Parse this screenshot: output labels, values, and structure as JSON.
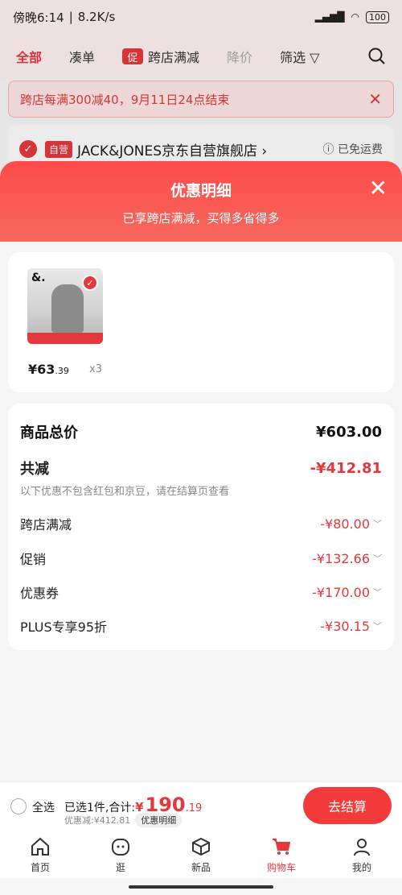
{
  "status_bar": {
    "time": "傍晚6:14",
    "speed": "8.2K/s",
    "battery": "100"
  },
  "tabs": [
    {
      "label": "全部"
    },
    {
      "label": "凑单"
    },
    {
      "label": "跨店满减",
      "badge": "促"
    },
    {
      "label": "降价"
    },
    {
      "label": "筛选"
    }
  ],
  "banner": {
    "text": "跨店每满300减40，9月11日24点结束"
  },
  "shop": {
    "badge": "自营",
    "name": "JACK&JONES京东自营旗舰店 ›",
    "shipping": "ⓘ 已免运费"
  },
  "sheet": {
    "title": "优惠明细",
    "subtitle": "已享跨店满减，买得多省得多",
    "product": {
      "price_int": "¥63",
      "price_dec": ".39",
      "qty": "x3",
      "thumb_text": "&."
    },
    "total_label": "商品总价",
    "total_value": "¥603.00",
    "saving_label": "共减",
    "saving_value": "-¥412.81",
    "note": "以下优惠不包含红包和京豆，请在结算页查看",
    "items": [
      {
        "label": "跨店满减",
        "value": "-¥80.00"
      },
      {
        "label": "促销",
        "value": "-¥132.66"
      },
      {
        "label": "优惠券",
        "value": "-¥170.00"
      },
      {
        "label": "PLUS专享95折",
        "value": "-¥30.15"
      }
    ]
  },
  "bottom": {
    "select_all": "全选",
    "summary_prefix": "已选1件,合计:",
    "cur": "¥",
    "amount_int": "190",
    "amount_dec": ".19",
    "discount": "优惠减:¥412.81",
    "detail_pill": "优惠明细",
    "checkout": "去结算"
  },
  "nav": [
    {
      "label": "首页",
      "icon": "home-icon"
    },
    {
      "label": "逛",
      "icon": "face-icon"
    },
    {
      "label": "新品",
      "icon": "cube-icon"
    },
    {
      "label": "购物车",
      "icon": "cart-icon",
      "active": true
    },
    {
      "label": "我的",
      "icon": "user-icon"
    }
  ],
  "colors": {
    "accent": "#e4393c",
    "sheet_header": "#ff4b4b"
  }
}
